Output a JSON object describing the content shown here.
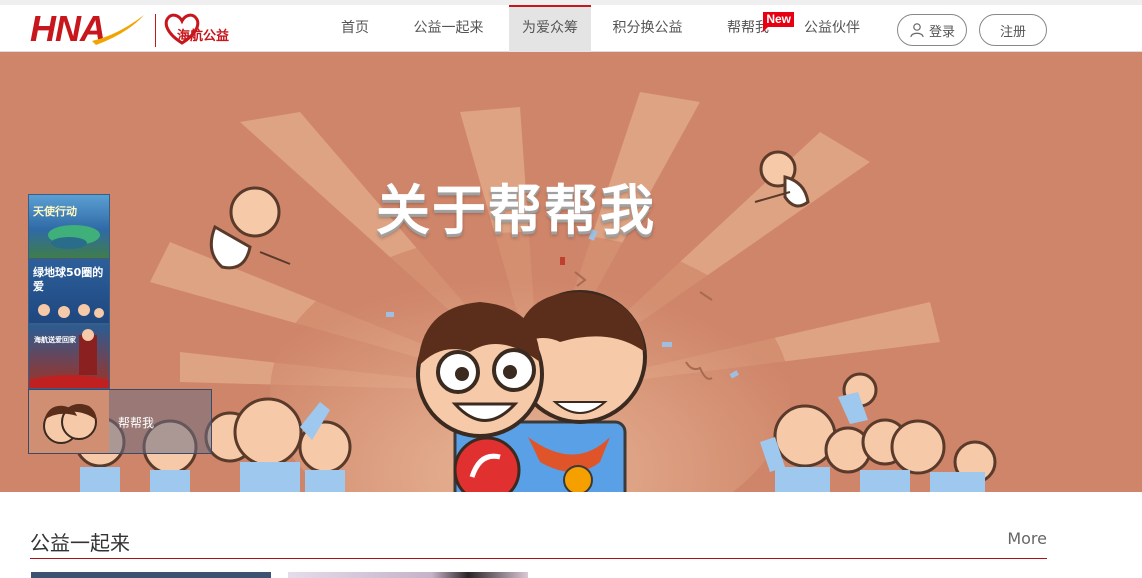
{
  "header": {
    "logo_text": "HNA",
    "charity_logo_text": "海航公益"
  },
  "nav": {
    "items": [
      {
        "label": "首页",
        "badge": ""
      },
      {
        "label": "公益一起来",
        "badge": ""
      },
      {
        "label": "为爱众筹",
        "badge": ""
      },
      {
        "label": "积分换公益",
        "badge": ""
      },
      {
        "label": "帮帮我",
        "badge": "New"
      },
      {
        "label": "公益伙伴",
        "badge": ""
      }
    ],
    "active": "为爱众筹"
  },
  "auth": {
    "login_label": "登录",
    "register_label": "注册"
  },
  "banner": {
    "title": "关于帮帮我",
    "thumbnails": [
      {
        "caption": "天使行动"
      },
      {
        "caption": "绿地球50圈的爱"
      },
      {
        "caption": "海航送爱回家"
      },
      {
        "caption": "帮帮我"
      }
    ]
  },
  "section": {
    "title": "公益一起来",
    "more_label": "More"
  },
  "colors": {
    "brand_red": "#c8161d",
    "banner_bg": "#cf8569",
    "new_badge": "#e60012"
  }
}
